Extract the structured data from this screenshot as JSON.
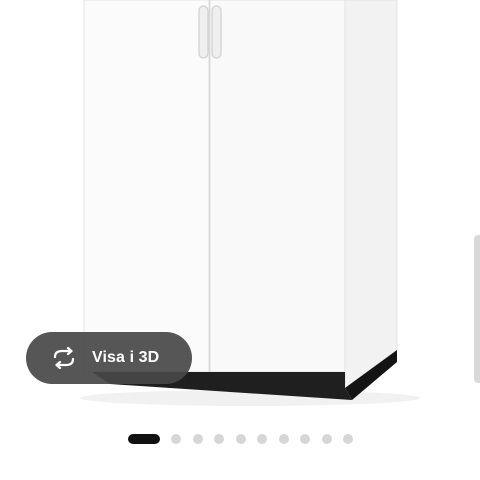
{
  "gallery": {
    "view_3d_label": "Visa i 3D",
    "view_3d_icon": "rotate-3d-icon",
    "slide_count": 10,
    "active_slide": 1,
    "colors": {
      "pill_background": "#484848",
      "dot_active": "#111111",
      "dot_inactive": "#d6d6d6",
      "cabinet_white": "#f7f7f7",
      "plinth_black": "#1a1a1a"
    }
  }
}
